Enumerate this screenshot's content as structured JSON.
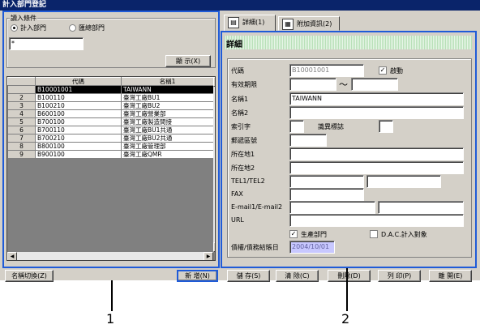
{
  "window_title": "計入部門登記",
  "query": {
    "group_label": "讀入條件",
    "radio_accounting": "計入部門",
    "radio_summary": "匯總部門",
    "search_value": "*",
    "show_button": "顯 示(X)"
  },
  "grid": {
    "columns": [
      "代碼",
      "名稱1"
    ],
    "rows": [
      {
        "num": "",
        "code": "B10001001",
        "name": "TAIWANN"
      },
      {
        "num": "2",
        "code": "B100110",
        "name": "臺灣工廠BU1"
      },
      {
        "num": "3",
        "code": "B100210",
        "name": "臺灣工廠BU2"
      },
      {
        "num": "4",
        "code": "B600100",
        "name": "臺灣工廠營業部"
      },
      {
        "num": "5",
        "code": "B700100",
        "name": "臺灣工廠製造間接"
      },
      {
        "num": "6",
        "code": "B700110",
        "name": "臺灣工廠BU1共通"
      },
      {
        "num": "7",
        "code": "B700210",
        "name": "臺灣工廠BU2共通"
      },
      {
        "num": "8",
        "code": "B800100",
        "name": "臺灣工廠管理部"
      },
      {
        "num": "9",
        "code": "B900100",
        "name": "臺灣工廠QMR"
      }
    ]
  },
  "tabs": [
    "詳細(1)",
    "附加資訊(2)"
  ],
  "detail": {
    "section_title": "詳細",
    "code_label": "代碼",
    "code_value": "B10001001",
    "active_label": "啟動",
    "period_label": "有效期限",
    "period_sep": "～",
    "name1_label": "名稱1",
    "name1_value": "TAIWANN",
    "name2_label": "名稱2",
    "index_label": "索引字",
    "flag_label": "識異標誌",
    "zip_label": "郵遞區號",
    "addr1_label": "所在地1",
    "addr2_label": "所在地2",
    "tel_label": "TEL1/TEL2",
    "fax_label": "FAX",
    "email_label": "E-mail1/E-mail2",
    "url_label": "URL",
    "production_label": "生產部門",
    "dac_label": "D.A.C.計入對象",
    "date_label": "債權/債務結賬日",
    "date_value": "2004/10/01"
  },
  "footer": {
    "switch_name": "名稱切換(Z)",
    "new": "新 增(N)",
    "save": "儲 存(S)",
    "clear": "清 除(C)",
    "delete": "刪除(D)",
    "print": "列 印(P)",
    "close": "離 開(E)"
  },
  "annotations": {
    "left": "1",
    "right": "2"
  },
  "colors": {
    "highlight": "#1f5bd8",
    "title_bg": "#0a246a"
  }
}
